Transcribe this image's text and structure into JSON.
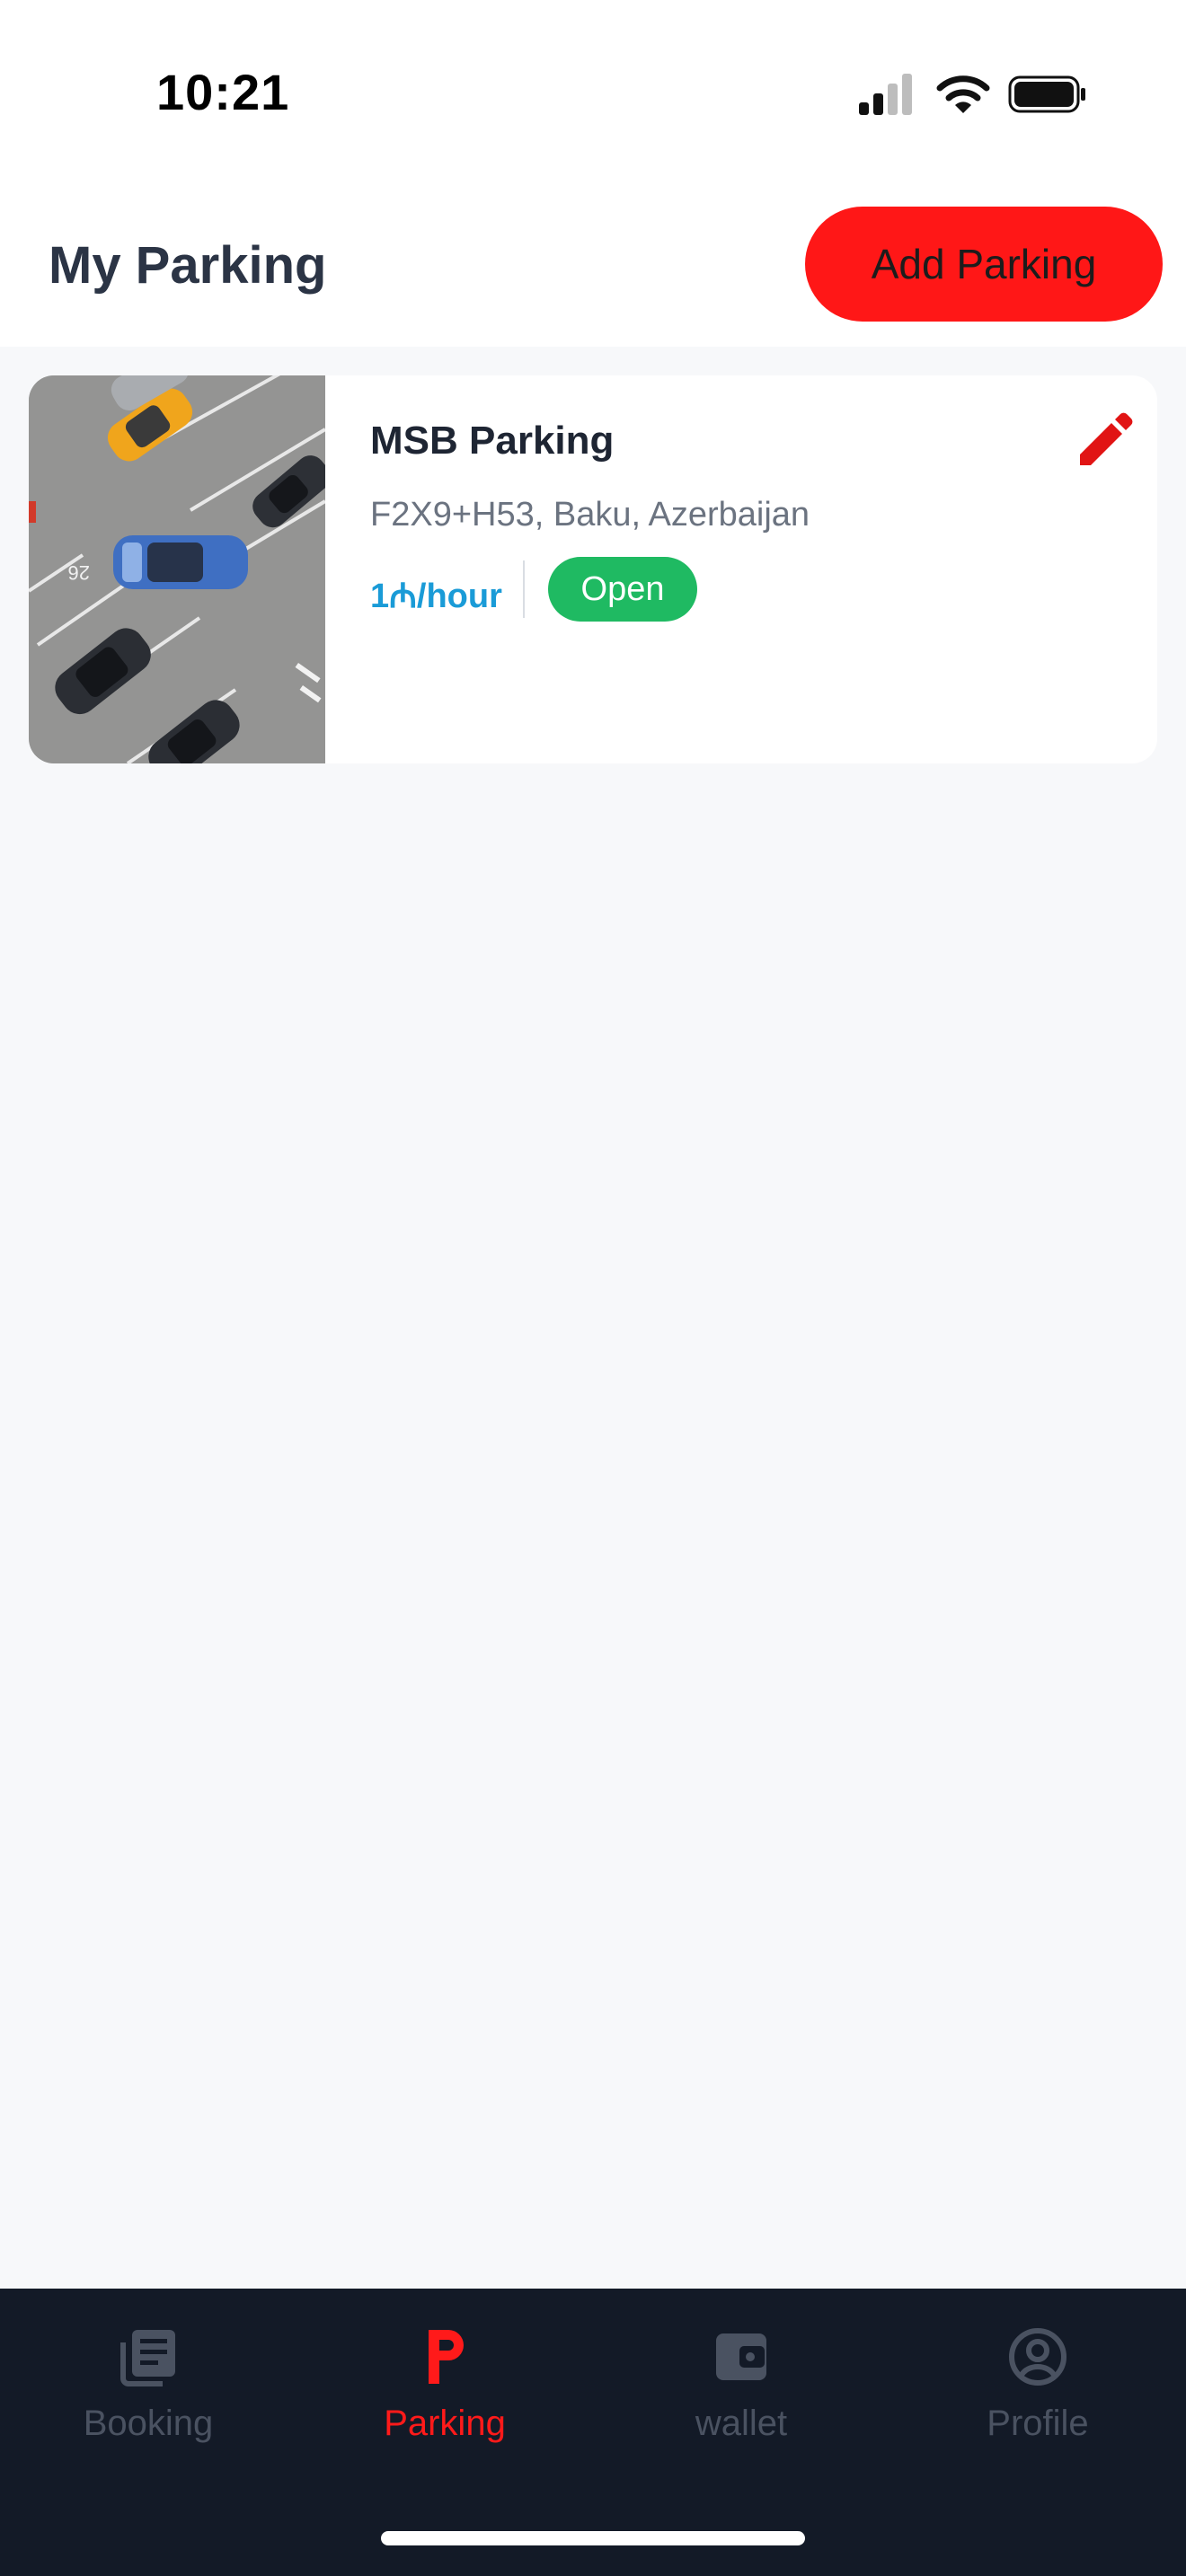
{
  "status_bar": {
    "time": "10:21"
  },
  "header": {
    "title": "My Parking",
    "add_button_label": "Add Parking"
  },
  "parking_list": [
    {
      "name": "MSB Parking",
      "address": "F2X9+H53, Baku, Azerbaijan",
      "price": "1₼/hour",
      "status": "Open",
      "image_icon": "parking-lot-photo"
    }
  ],
  "bottom_nav": {
    "items": [
      {
        "label": "Booking",
        "icon": "booking-icon",
        "active": false
      },
      {
        "label": "Parking",
        "icon": "parking-icon",
        "active": true
      },
      {
        "label": "wallet",
        "icon": "wallet-icon",
        "active": false
      },
      {
        "label": "Profile",
        "icon": "profile-icon",
        "active": false
      }
    ]
  },
  "colors": {
    "accent": "#ff1717",
    "open_badge": "#1fba62",
    "price_text": "#1a9bd7",
    "nav_background": "#131a27"
  }
}
